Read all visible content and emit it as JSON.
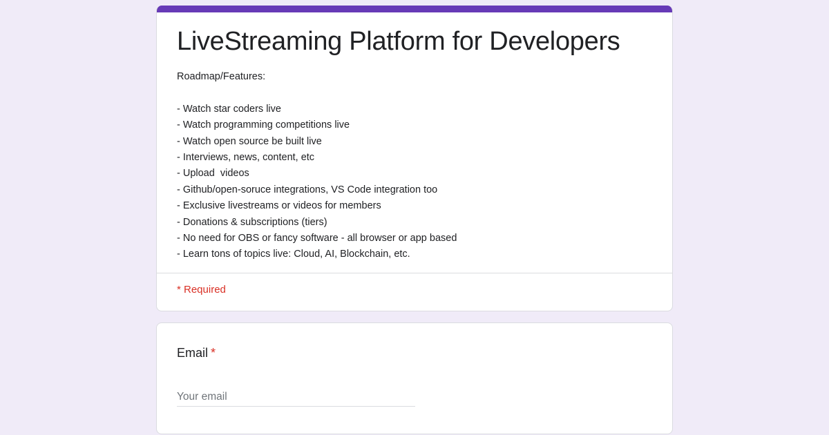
{
  "form": {
    "title": "LiveStreaming Platform for Developers",
    "accent_color": "#673ab7",
    "required_color": "#d93025",
    "background_color": "#f0ebf8",
    "description": {
      "heading": "Roadmap/Features:",
      "items": [
        "- Watch star coders live",
        "- Watch programming competitions live",
        "- Watch open source be built live",
        "- Interviews, news, content, etc",
        "- Upload  videos",
        "- Github/open-soruce integrations, VS Code integration too",
        "- Exclusive livestreams or videos for members",
        "- Donations & subscriptions (tiers)",
        "- No need for OBS or fancy software - all browser or app based",
        "- Learn tons of topics live: Cloud, AI, Blockchain, etc."
      ]
    },
    "required_note": "* Required"
  },
  "email_question": {
    "label": "Email",
    "required_marker": "*",
    "placeholder": "Your email",
    "value": ""
  }
}
